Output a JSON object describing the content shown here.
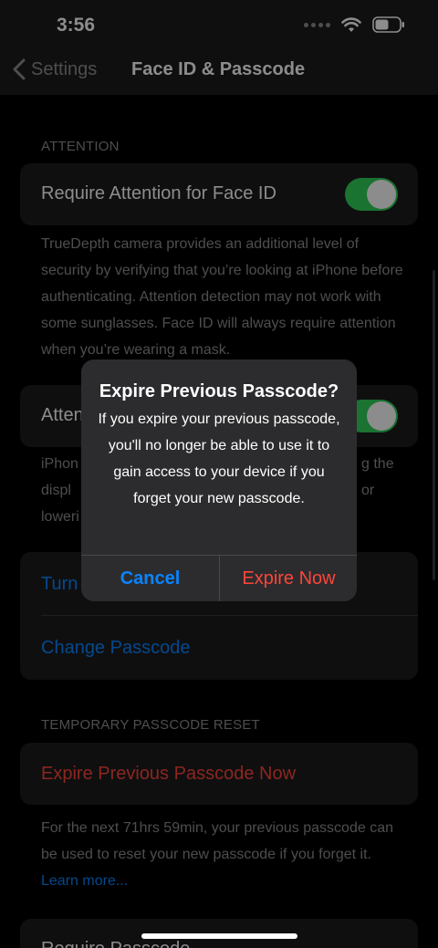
{
  "status": {
    "time": "3:56"
  },
  "nav": {
    "back_label": "Settings",
    "title": "Face ID & Passcode"
  },
  "attention": {
    "header": "ATTENTION",
    "require_label": "Require Attention for Face ID",
    "require_on": true,
    "footnote": "TrueDepth camera provides an additional level of security by verifying that you’re looking at iPhone before authenticating. Attention detection may not work with some sunglasses. Face ID will always require attention when you’re wearing a mask.",
    "aware_label": "Atten",
    "aware_on": true,
    "aware_footnote_left": [
      "iPhon",
      "displ",
      "loweri"
    ],
    "aware_footnote_right": [
      "g the",
      "or",
      ""
    ]
  },
  "passcode": {
    "turn_off_label": "Turn",
    "change_label": "Change Passcode"
  },
  "temp_reset": {
    "header": "TEMPORARY PASSCODE RESET",
    "expire_label": "Expire Previous Passcode Now",
    "footnote": "For the next 71hrs 59min, your previous passcode can be used to reset your new passcode if you forget it.",
    "learn_more": "Learn more..."
  },
  "bottom_row": {
    "label": "Require Passcode"
  },
  "alert": {
    "title": "Expire Previous Passcode?",
    "message": "If you expire your previous passcode, you'll no longer be able to use it to gain access to your device if you forget your new passcode.",
    "cancel_label": "Cancel",
    "confirm_label": "Expire Now"
  },
  "colors": {
    "accent": "#0a84ff",
    "destructive": "#ff453a",
    "toggle_on": "#30d158"
  }
}
